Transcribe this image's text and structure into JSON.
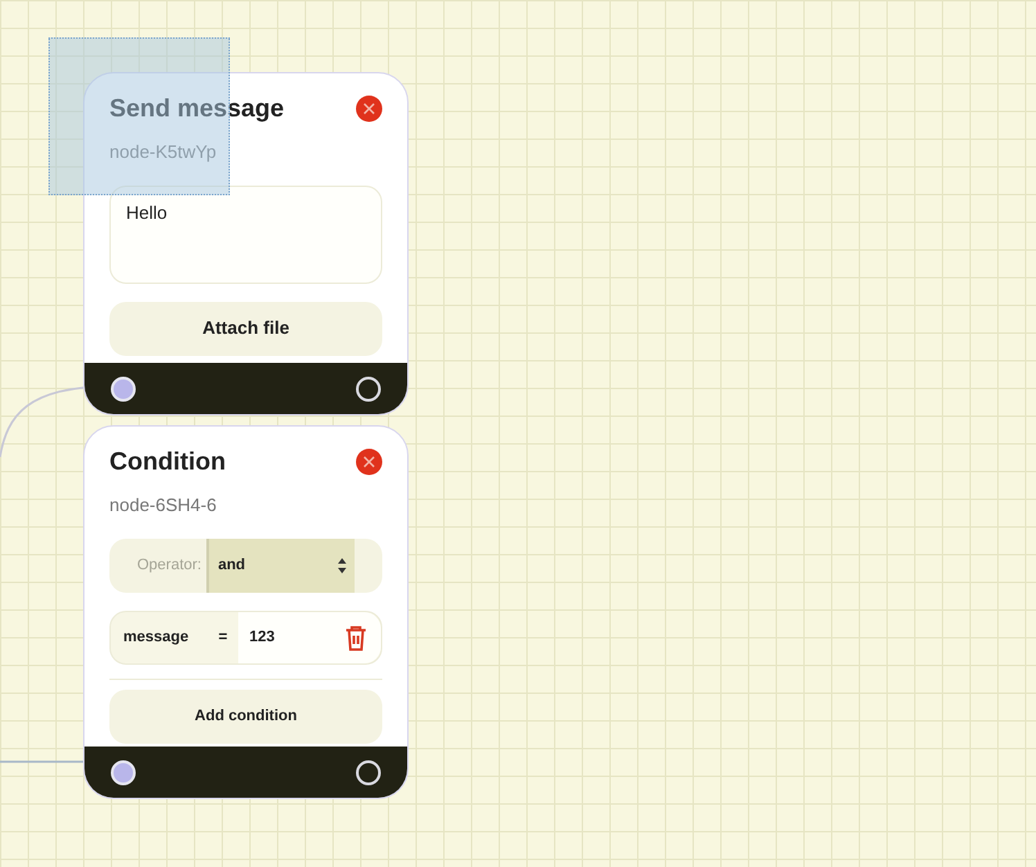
{
  "nodes": [
    {
      "kind": "message",
      "title": "Send message",
      "node_id": "node-K5twYp",
      "message": "Hello",
      "button": "Attach file",
      "ports": [
        {
          "connected": true
        },
        {
          "connected": false
        }
      ]
    },
    {
      "kind": "condition",
      "title": "Condition",
      "node_id": "node-6SH4-6",
      "operator_label": "Operator:",
      "operator": "and",
      "conditions": [
        {
          "field": "message",
          "op": "=",
          "value": "123"
        }
      ],
      "button": "Add condition",
      "ports": [
        {
          "connected": true
        },
        {
          "connected": false
        }
      ]
    }
  ]
}
